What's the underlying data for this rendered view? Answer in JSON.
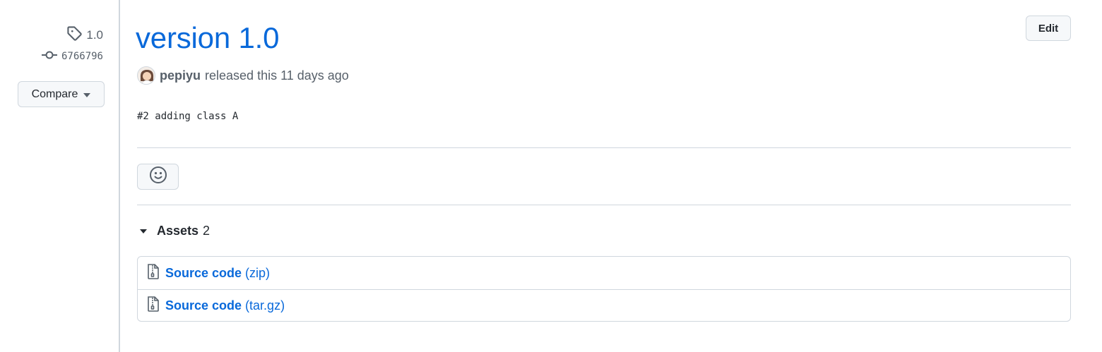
{
  "sidebar": {
    "tag_label": "1.0",
    "commit_sha": "6766796",
    "compare_label": "Compare"
  },
  "release": {
    "title": "version 1.0",
    "edit_label": "Edit",
    "author": "pepiyu",
    "released_text": "released this 11 days ago",
    "notes": "#2 adding class A"
  },
  "assets": {
    "title": "Assets",
    "count": "2",
    "items": [
      {
        "label": "Source code",
        "ext": "(zip)"
      },
      {
        "label": "Source code",
        "ext": "(tar.gz)"
      }
    ]
  },
  "colors": {
    "link": "#0969da",
    "border": "#d0d7de",
    "muted": "#57606a",
    "button_bg": "#f6f8fa"
  },
  "icons": {
    "tag": "tag-icon",
    "commit": "git-commit-icon",
    "reaction": "smiley-icon",
    "archive": "file-zip-icon"
  }
}
